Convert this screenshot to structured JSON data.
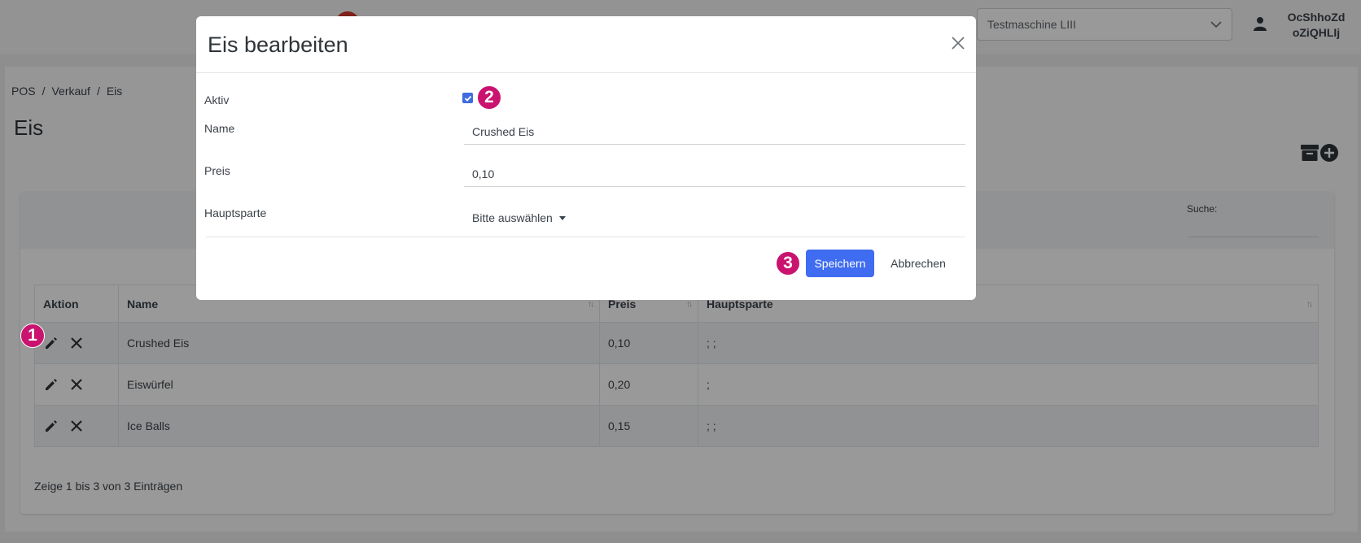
{
  "topbar": {
    "machine_select": "Testmaschine LIII",
    "user_line1": "OcShhoZd",
    "user_line2": "oZiQHLIj"
  },
  "breadcrumb": [
    "POS",
    "/",
    "Verkauf",
    "/",
    "Eis"
  ],
  "page_title": "Eis",
  "search": {
    "label": "Suche:",
    "value": ""
  },
  "table": {
    "headers": [
      "Aktion",
      "Name",
      "Preis",
      "Hauptsparte"
    ],
    "rows": [
      {
        "name": "Crushed Eis",
        "preis": "0,10",
        "hauptsparte": "; ;"
      },
      {
        "name": "Eiswürfel",
        "preis": "0,20",
        "hauptsparte": ";"
      },
      {
        "name": "Ice Balls",
        "preis": "0,15",
        "hauptsparte": "; ;"
      }
    ],
    "footer": "Zeige 1 bis 3 von 3 Einträgen"
  },
  "modal": {
    "title": "Eis bearbeiten",
    "aktiv_label": "Aktiv",
    "aktiv_checked": true,
    "name_label": "Name",
    "name_value": "Crushed Eis",
    "preis_label": "Preis",
    "preis_value": "0,10",
    "hauptsparte_label": "Hauptsparte",
    "hauptsparte_value": "Bitte auswählen",
    "save_label": "Speichern",
    "cancel_label": "Abbrechen"
  },
  "markers": [
    "1",
    "2",
    "3"
  ],
  "colors": {
    "accent": "#3f6cf0",
    "marker": "#c9136f",
    "brand": "#d33a2c"
  }
}
